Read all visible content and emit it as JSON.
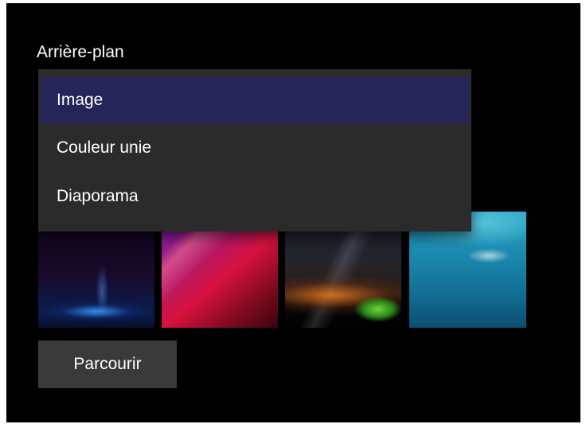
{
  "background_section": {
    "title": "Arrière-plan"
  },
  "background_type_dropdown": {
    "options": [
      "Image",
      "Couleur unie",
      "Diaporama"
    ],
    "selected": "Image",
    "selected_color": "#25255a",
    "menu_color": "#2b2b2b"
  },
  "recent_images": [
    {
      "icon": "night-sky-blue-light-image"
    },
    {
      "icon": "red-purple-abstract-image"
    },
    {
      "icon": "milky-way-tent-image"
    },
    {
      "icon": "underwater-swimmer-image"
    }
  ],
  "browse_button": {
    "label": "Parcourir"
  }
}
